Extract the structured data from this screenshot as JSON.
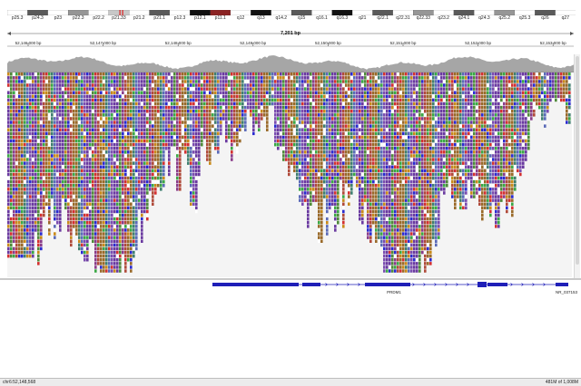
{
  "ideogram": {
    "bands": [
      {
        "label": "p25.3",
        "stain": "gneg"
      },
      {
        "label": "p24.3",
        "stain": "gpos75"
      },
      {
        "label": "p23",
        "stain": "gneg"
      },
      {
        "label": "p22.3",
        "stain": "gpos50"
      },
      {
        "label": "p22.2",
        "stain": "gneg"
      },
      {
        "label": "p21.33",
        "stain": "gpos25"
      },
      {
        "label": "p21.2",
        "stain": "gneg"
      },
      {
        "label": "p21.1",
        "stain": "gpos75"
      },
      {
        "label": "p12.3",
        "stain": "gneg"
      },
      {
        "label": "p12.1",
        "stain": "gpos100"
      },
      {
        "label": "p11.1",
        "stain": "acen"
      },
      {
        "label": "q12",
        "stain": "gneg"
      },
      {
        "label": "q13",
        "stain": "gpos100"
      },
      {
        "label": "q14.2",
        "stain": "gneg"
      },
      {
        "label": "q15",
        "stain": "gpos75"
      },
      {
        "label": "q16.1",
        "stain": "gneg"
      },
      {
        "label": "q16.3",
        "stain": "gpos100"
      },
      {
        "label": "q21",
        "stain": "gneg"
      },
      {
        "label": "q22.1",
        "stain": "gpos75"
      },
      {
        "label": "q22.31",
        "stain": "gneg"
      },
      {
        "label": "q22.33",
        "stain": "gpos50"
      },
      {
        "label": "q23.2",
        "stain": "gneg"
      },
      {
        "label": "q24.1",
        "stain": "gpos75"
      },
      {
        "label": "q24.3",
        "stain": "gneg"
      },
      {
        "label": "q25.2",
        "stain": "gpos50"
      },
      {
        "label": "q25.3",
        "stain": "gneg"
      },
      {
        "label": "q26",
        "stain": "gpos75"
      },
      {
        "label": "q27",
        "stain": "gneg"
      }
    ],
    "stain_colors": {
      "gneg": "#ffffff",
      "gpos25": "#c8c8c8",
      "gpos50": "#969696",
      "gpos75": "#5a5a5a",
      "gpos100": "#111111",
      "acen": "#8b2323"
    },
    "current_region_marker_color": "#e00000"
  },
  "ruler": {
    "span_label": "7,201 bp",
    "ticks": [
      "52,146,000 bp",
      "52,147,000 bp",
      "52,148,000 bp",
      "52,149,000 bp",
      "52,150,000 bp",
      "52,151,000 bp",
      "52,152,000 bp",
      "52,153,000 bp"
    ]
  },
  "coverage": {
    "color": "#a6a6a6",
    "baseline_color": "#8c8c8c"
  },
  "alignments": {
    "base_colors": {
      "A": "#3aa845",
      "C": "#2a2ad0",
      "G": "#c98a1a",
      "T": "#d43030"
    },
    "read_tints": [
      "#6a3aa0",
      "#7b4db0",
      "#5a6ab8",
      "#3f7f6f",
      "#9a6a2a",
      "#b04a3a",
      "#8a3c8a",
      "#4f8a3a"
    ],
    "background": "#f4f4f4"
  },
  "genes": {
    "color": "#1f1fb8",
    "labels": [
      "PRDM1",
      "NR_037153"
    ]
  },
  "status": {
    "locus": "chr6:52,148,568",
    "memory": "481M of 1,008M"
  }
}
